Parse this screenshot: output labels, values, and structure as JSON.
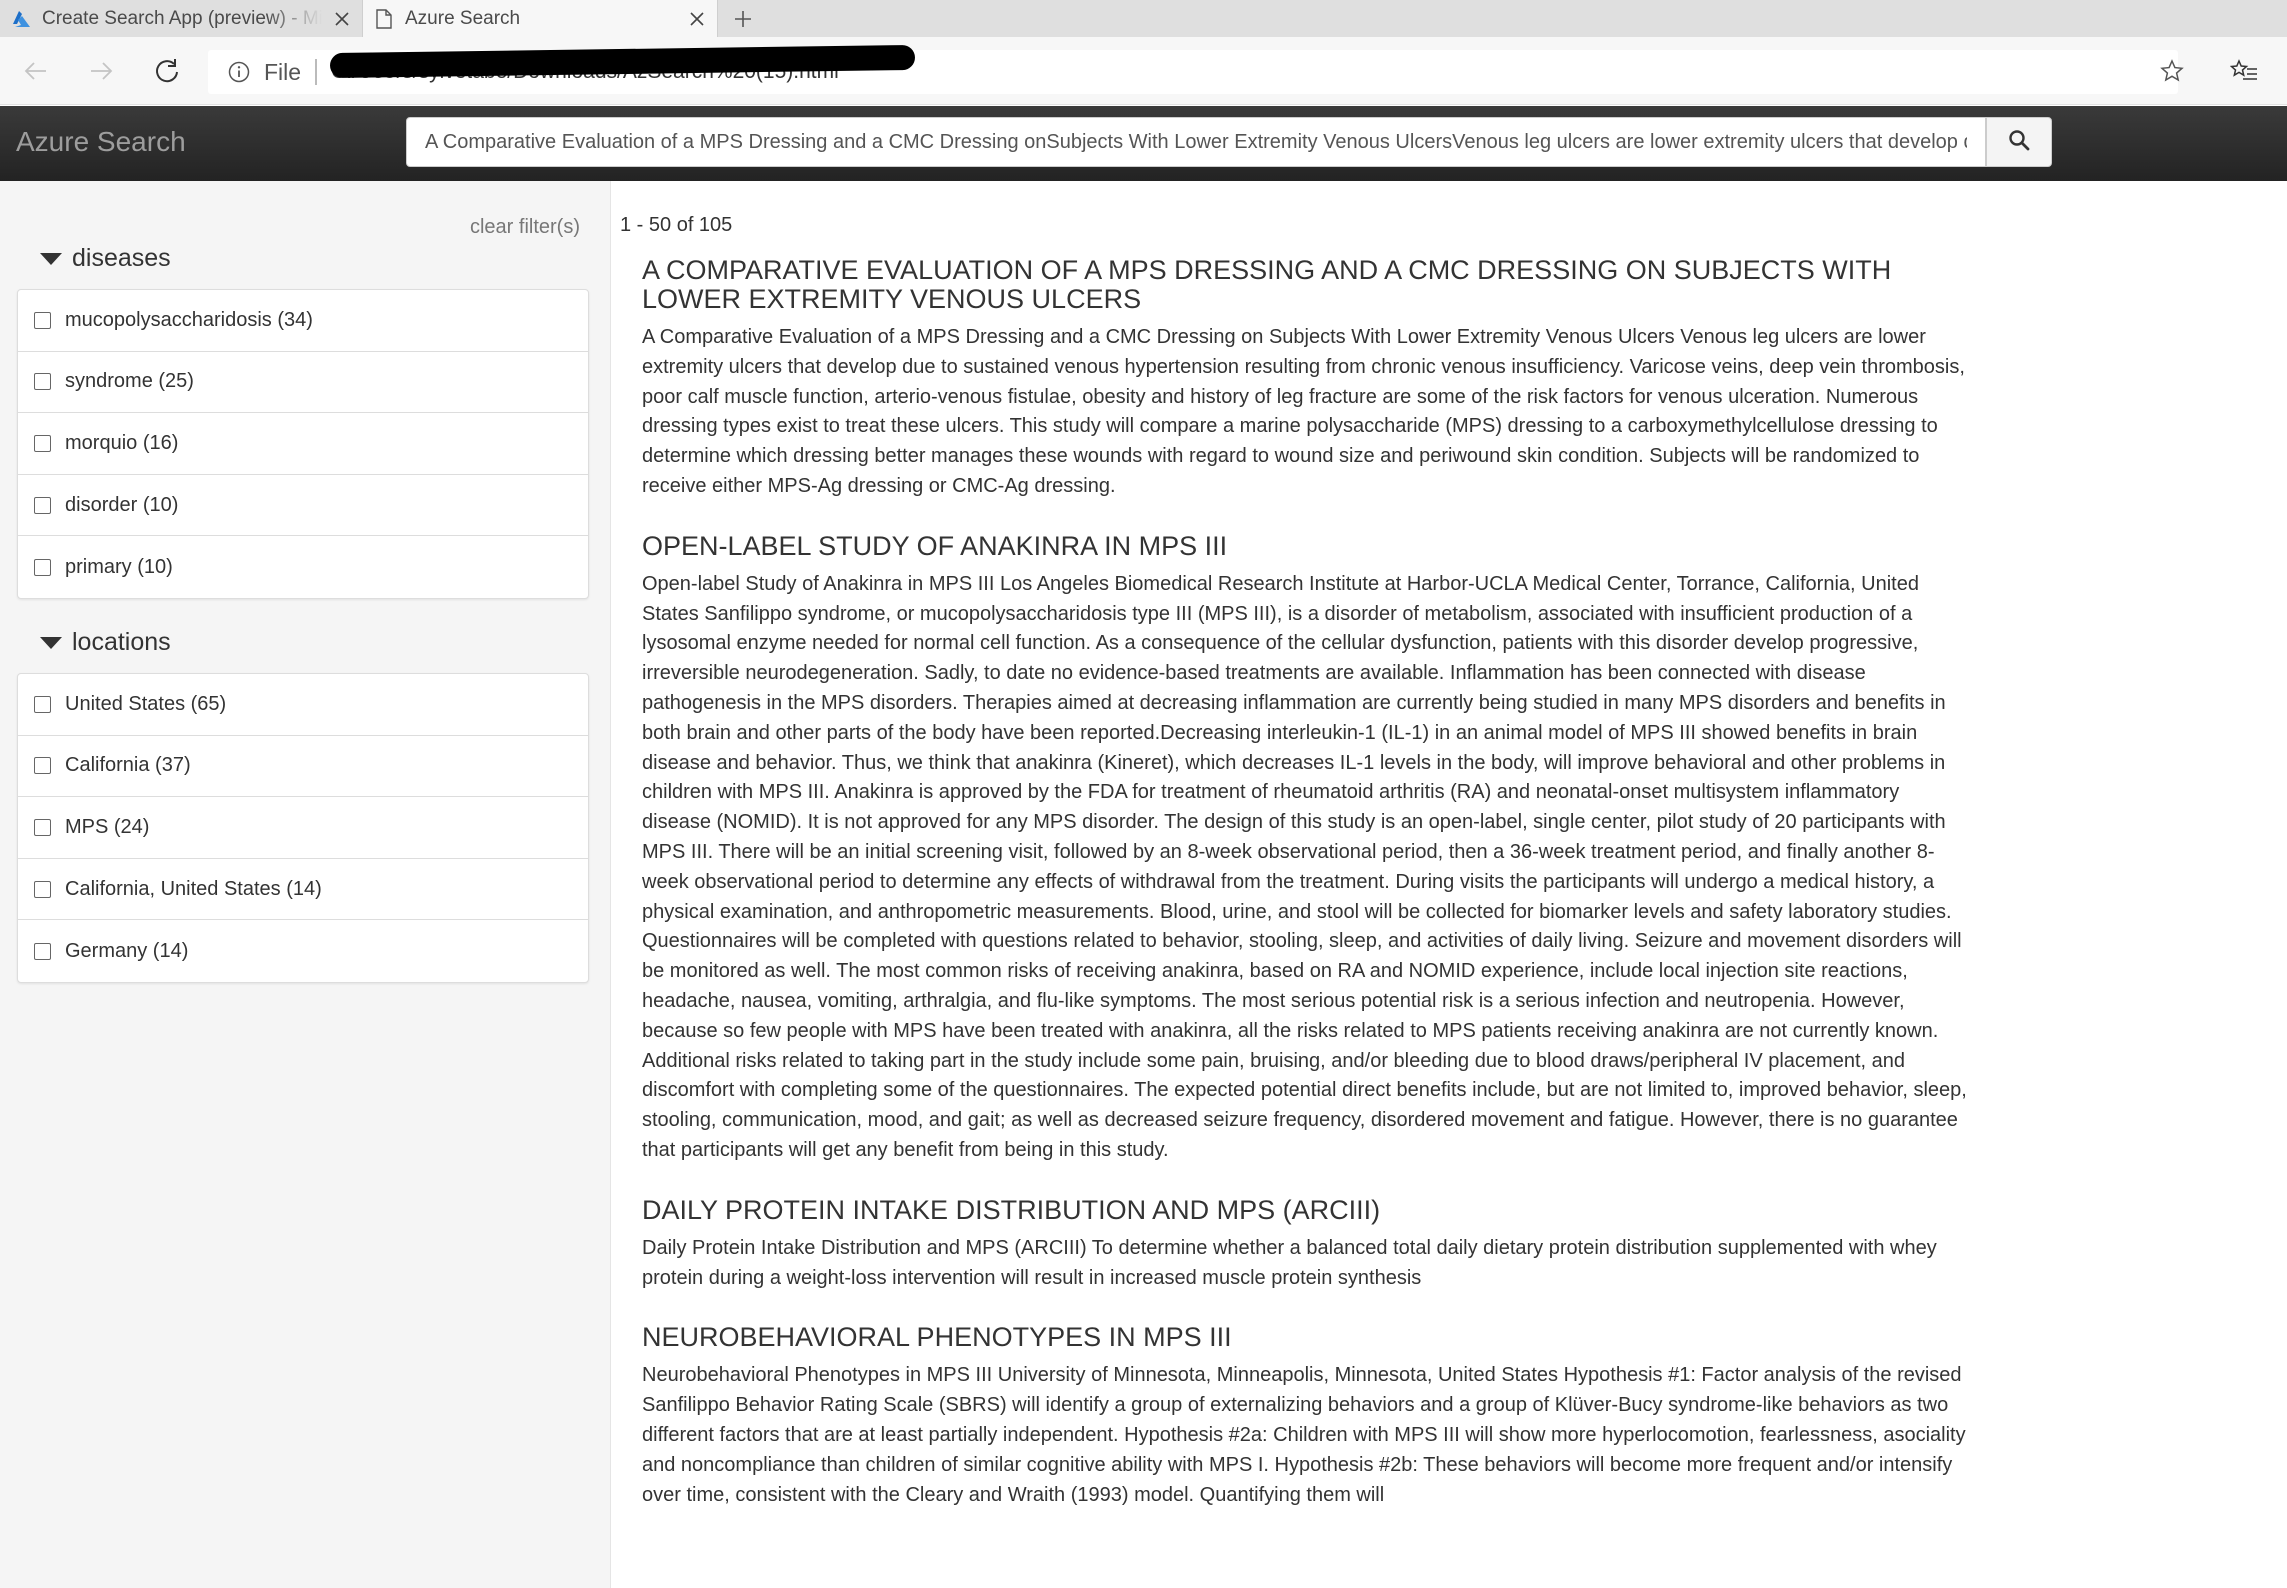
{
  "browser": {
    "tabs": [
      {
        "title": "Create Search App (preview) - Microsoft Azure"
      },
      {
        "title": "Azure Search"
      }
    ],
    "address": {
      "scheme_label": "File",
      "url": "C:/Users/sylvetabe/Downloads/AzSearch%20(15).html"
    }
  },
  "app": {
    "brand": "Azure Search",
    "search": {
      "value": "A Comparative Evaluation of a MPS Dressing and a CMC Dressing onSubjects With Lower Extremity Venous UlcersVenous leg ulcers are lower extremity ulcers that develop due to sustained venous hypertension"
    }
  },
  "sidebar": {
    "clear_filters": "clear filter(s)",
    "facets": [
      {
        "name": "diseases",
        "items": [
          {
            "label": "mucopolysaccharidosis (34)"
          },
          {
            "label": "syndrome (25)"
          },
          {
            "label": "morquio (16)"
          },
          {
            "label": "disorder (10)"
          },
          {
            "label": "primary (10)"
          }
        ]
      },
      {
        "name": "locations",
        "items": [
          {
            "label": "United States (65)"
          },
          {
            "label": "California (37)"
          },
          {
            "label": "MPS (24)"
          },
          {
            "label": "California, United States (14)"
          },
          {
            "label": "Germany (14)"
          }
        ]
      }
    ]
  },
  "results": {
    "count": "1 - 50 of 105",
    "items": [
      {
        "title": "A Comparative Evaluation of a MPS Dressing and a CMC Dressing on Subjects With Lower Extremity Venous Ulcers",
        "description": "A Comparative Evaluation of a MPS Dressing and a CMC Dressing on Subjects With Lower Extremity Venous Ulcers Venous leg ulcers are lower extremity ulcers that develop due to sustained venous hypertension resulting from chronic venous insufficiency. Varicose veins, deep vein thrombosis, poor calf muscle function, arterio-venous fistulae, obesity and history of leg fracture are some of the risk factors for venous ulceration. Numerous dressing types exist to treat these ulcers. This study will compare a marine polysaccharide (MPS) dressing to a carboxymethylcellulose dressing to determine which dressing better manages these wounds with regard to wound size and periwound skin condition. Subjects will be randomized to receive either MPS-Ag dressing or CMC-Ag dressing."
      },
      {
        "title": "Open-label Study of Anakinra in MPS III",
        "description": "Open-label Study of Anakinra in MPS III Los Angeles Biomedical Research Institute at Harbor-UCLA Medical Center, Torrance, California, United States Sanfilippo syndrome, or mucopolysaccharidosis type III (MPS III), is a disorder of metabolism, associated with insufficient production of a lysosomal enzyme needed for normal cell function. As a consequence of the cellular dysfunction, patients with this disorder develop progressive, irreversible neurodegeneration. Sadly, to date no evidence-based treatments are available. Inflammation has been connected with disease pathogenesis in the MPS disorders. Therapies aimed at decreasing inflammation are currently being studied in many MPS disorders and benefits in both brain and other parts of the body have been reported.Decreasing interleukin-1 (IL-1) in an animal model of MPS III showed benefits in brain disease and behavior. Thus, we think that anakinra (Kineret), which decreases IL-1 levels in the body, will improve behavioral and other problems in children with MPS III. Anakinra is approved by the FDA for treatment of rheumatoid arthritis (RA) and neonatal-onset multisystem inflammatory disease (NOMID). It is not approved for any MPS disorder. The design of this study is an open-label, single center, pilot study of 20 participants with MPS III. There will be an initial screening visit, followed by an 8-week observational period, then a 36-week treatment period, and finally another 8-week observational period to determine any effects of withdrawal from the treatment. During visits the participants will undergo a medical history, a physical examination, and anthropometric measurements. Blood, urine, and stool will be collected for biomarker levels and safety laboratory studies. Questionnaires will be completed with questions related to behavior, stooling, sleep, and activities of daily living. Seizure and movement disorders will be monitored as well. The most common risks of receiving anakinra, based on RA and NOMID experience, include local injection site reactions, headache, nausea, vomiting, arthralgia, and flu-like symptoms. The most serious potential risk is a serious infection and neutropenia. However, because so few people with MPS have been treated with anakinra, all the risks related to MPS patients receiving anakinra are not currently known. Additional risks related to taking part in the study include some pain, bruising, and/or bleeding due to blood draws/peripheral IV placement, and discomfort with completing some of the questionnaires. The expected potential direct benefits include, but are not limited to, improved behavior, sleep, stooling, communication, mood, and gait; as well as decreased seizure frequency, disordered movement and fatigue. However, there is no guarantee that participants will get any benefit from being in this study."
      },
      {
        "title": "Daily Protein Intake Distribution and MPS (ARCIII)",
        "description": "Daily Protein Intake Distribution and MPS (ARCIII) To determine whether a balanced total daily dietary protein distribution supplemented with whey protein during a weight-loss intervention will result in increased muscle protein synthesis"
      },
      {
        "title": "Neurobehavioral Phenotypes in MPS III",
        "description": "Neurobehavioral Phenotypes in MPS III University of Minnesota, Minneapolis, Minnesota, United States Hypothesis #1: Factor analysis of the revised Sanfilippo Behavior Rating Scale (SBRS) will identify a group of externalizing behaviors and a group of Klüver-Bucy syndrome-like behaviors as two different factors that are at least partially independent. Hypothesis #2a: Children with MPS III will show more hyperlocomotion, fearlessness, asociality and noncompliance than children of similar cognitive ability with MPS I. Hypothesis #2b: These behaviors will become more frequent and/or intensify over time, consistent with the Cleary and Wraith (1993) model. Quantifying them will"
      }
    ]
  }
}
